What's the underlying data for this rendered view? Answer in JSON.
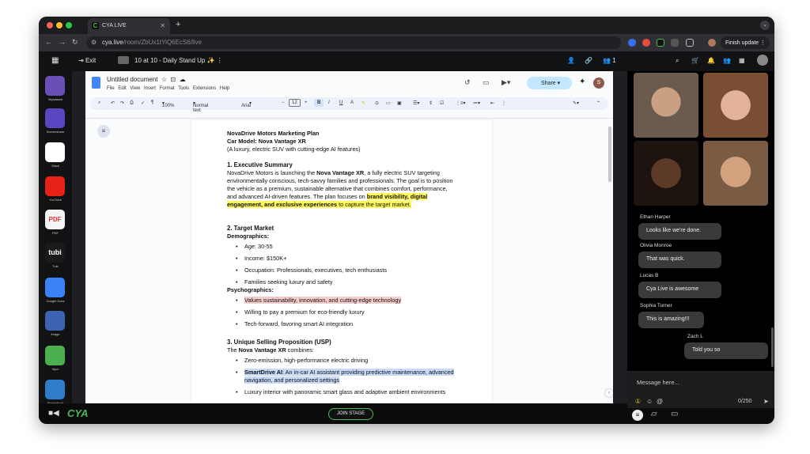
{
  "browser": {
    "tab_title": "CYA LIVE",
    "tab_favicon": "C",
    "new_tab": "+",
    "url_host": "cya.live",
    "url_path": "/room/ZbUx1tYiQ6EcS6/live",
    "finish_update": "Finish update",
    "nav_back": "←",
    "nav_forward": "→",
    "nav_reload": "↻"
  },
  "appbar": {
    "exit_label": "Exit",
    "meeting_title": "10 at 10 - Daily Stand Up ✨",
    "participant_count": "1"
  },
  "sidebar": {
    "apps": [
      {
        "label": "Mywassta",
        "color": "#6a4fb6"
      },
      {
        "label": "Screenshare",
        "color": "#5b46c2"
      },
      {
        "label": "Slack",
        "color": "#ffffff"
      },
      {
        "label": "YouTube",
        "color": "#e62117"
      },
      {
        "label": "PDF",
        "color": "#f4f4f4"
      },
      {
        "label": "Tubi",
        "color": "#1a1a1a"
      },
      {
        "label": "Google Docs",
        "color": "#3b82f6"
      },
      {
        "label": "Image",
        "color": "#3e63b5"
      },
      {
        "label": "Mp4",
        "color": "#4caf50"
      },
      {
        "label": "Sketchbook",
        "color": "#2f7cc9"
      }
    ],
    "pdf_text": "PDF",
    "tubi_text": "tubi"
  },
  "docs": {
    "title": "Untitled document",
    "menu": [
      "File",
      "Edit",
      "View",
      "Insert",
      "Format",
      "Tools",
      "Extensions",
      "Help"
    ],
    "share_label": "Share",
    "avatar_letter": "S",
    "zoom": "100%",
    "style": "Normal text",
    "font": "Arial",
    "font_size": "12",
    "toolbar_bold": "B",
    "toolbar_italic": "I",
    "toolbar_underline": "U"
  },
  "document": {
    "title": "NovaDrive Motors Marketing Plan",
    "car_model": "Car Model: Nova Vantage XR",
    "tagline": "(A luxury, electric SUV with cutting-edge AI features)",
    "s1_heading": "1. Executive Summary",
    "s1_a": "NovaDrive Motors is launching the ",
    "s1_b": "Nova Vantage XR",
    "s1_c": ", a fully electric SUV targeting environmentally conscious, tech-savvy families and professionals. The goal is to position the vehicle as a premium, sustainable alternative that combines comfort, performance, and advanced AI-driven features. The plan focuses on ",
    "s1_d": "brand visibility, digital engagement, and exclusive experiences",
    "s1_e": " to capture the target market.",
    "s2_heading": "2. Target Market",
    "demographics": "Demographics:",
    "demo_items": [
      "Age: 30-55",
      "Income: $150K+",
      "Occupation: Professionals, executives, tech enthusiasts",
      "Families seeking luxury and safety"
    ],
    "psychographics": "Psychographics:",
    "psych_items": [
      "Values sustainability, innovation, and cutting-edge technology",
      "Willing to pay a premium for eco-friendly luxury",
      "Tech-forward, favoring smart AI integration"
    ],
    "s3_heading": "3. Unique Selling Proposition (USP)",
    "s3_a": "The ",
    "s3_b": "Nova Vantage XR",
    "s3_c": " combines:",
    "usp_1": "Zero-emission, high-performance electric driving",
    "usp_2a": "SmartDrive AI",
    "usp_2b": ": An in-car AI assistant providing predictive maintenance, advanced navigation, and personalized settings",
    "usp_3": "Luxury interior with panoramic smart glass and adaptive ambient environments"
  },
  "chat": {
    "messages": [
      {
        "name": "Ethan Harper",
        "text": "Looks like we're done."
      },
      {
        "name": "Olivia Monroe",
        "text": "That was quick."
      },
      {
        "name": "Lucas B",
        "text": "Cya Live is awesome"
      },
      {
        "name": "Sophia Turner",
        "text": "This is amazing!!!"
      },
      {
        "name": "Zach L",
        "text": "Told you so"
      }
    ],
    "placeholder": "Message here...",
    "counter": "0/250",
    "send": "➤"
  },
  "bottom": {
    "join_stage": "JOIN STAGE",
    "logo": "CYA"
  },
  "colors": {
    "accent_green": "#4db85a",
    "share_blue": "#c2e7ff",
    "highlight_yellow": "#fff95c"
  }
}
